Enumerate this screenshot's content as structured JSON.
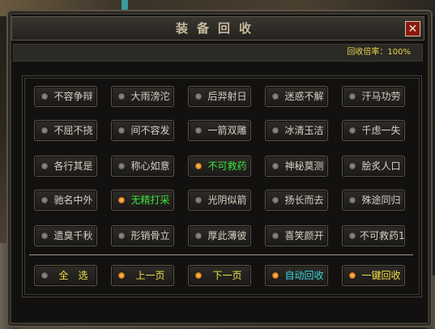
{
  "window": {
    "title": "装备回收",
    "close_symbol": "✕",
    "recycle_rate_text": "回收倍率：100%"
  },
  "items": [
    {
      "label": "不容争辩",
      "selected": false
    },
    {
      "label": "大雨滂沱",
      "selected": false
    },
    {
      "label": "后羿射日",
      "selected": false
    },
    {
      "label": "迷惑不解",
      "selected": false
    },
    {
      "label": "汗马功劳",
      "selected": false
    },
    {
      "label": "不屈不挠",
      "selected": false
    },
    {
      "label": "间不容发",
      "selected": false
    },
    {
      "label": "一箭双雕",
      "selected": false
    },
    {
      "label": "冰清玉洁",
      "selected": false
    },
    {
      "label": "千虑一失",
      "selected": false
    },
    {
      "label": "各行其是",
      "selected": false
    },
    {
      "label": "称心如意",
      "selected": false
    },
    {
      "label": "不可救药",
      "selected": true
    },
    {
      "label": "神秘莫测",
      "selected": false
    },
    {
      "label": "脍炙人口",
      "selected": false
    },
    {
      "label": "驰名中外",
      "selected": false
    },
    {
      "label": "无精打采",
      "selected": true
    },
    {
      "label": "光阴似箭",
      "selected": false
    },
    {
      "label": "扬长而去",
      "selected": false
    },
    {
      "label": "殊途同归",
      "selected": false
    },
    {
      "label": "遗臭千秋",
      "selected": false
    },
    {
      "label": "形销骨立",
      "selected": false
    },
    {
      "label": "厚此薄彼",
      "selected": false
    },
    {
      "label": "喜笑颜开",
      "selected": false
    },
    {
      "label": "不可救药1",
      "selected": false
    }
  ],
  "actions": {
    "select_all": "全　选",
    "prev_page": "上一页",
    "next_page": "下一页",
    "auto_recycle": "自动回收",
    "one_click_recycle": "一键回收"
  },
  "colors": {
    "selected_text": "#3ee23a",
    "action_text": "#f0e04a",
    "auto_recycle_text": "#35d8e0",
    "rate_text": "#e7d64a",
    "close_bg": "#8a1a12"
  }
}
